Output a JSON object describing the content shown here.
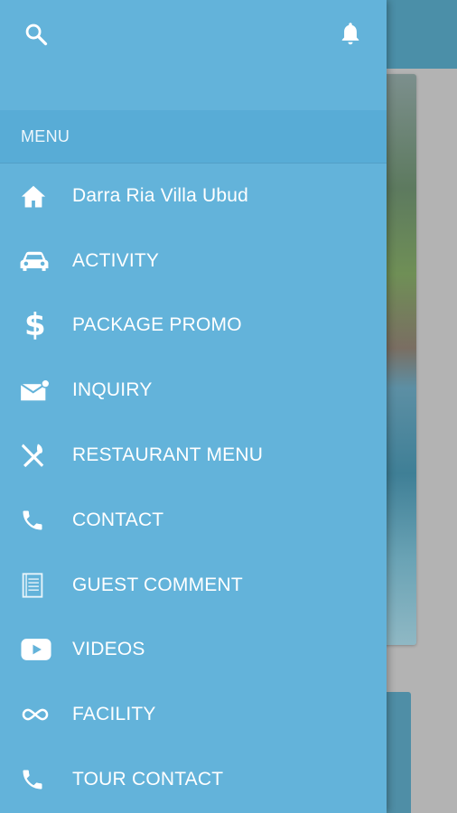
{
  "drawer": {
    "menu_header": "MENU",
    "items": [
      {
        "label": "Darra Ria Villa Ubud",
        "icon": "home-icon"
      },
      {
        "label": "ACTIVITY",
        "icon": "car-icon"
      },
      {
        "label": "PACKAGE PROMO",
        "icon": "dollar-icon"
      },
      {
        "label": "INQUIRY",
        "icon": "mail-notification-icon"
      },
      {
        "label": "RESTAURANT MENU",
        "icon": "cutlery-icon"
      },
      {
        "label": "CONTACT",
        "icon": "phone-icon"
      },
      {
        "label": "GUEST COMMENT",
        "icon": "notepad-icon"
      },
      {
        "label": "VIDEOS",
        "icon": "youtube-icon"
      },
      {
        "label": "FACILITY",
        "icon": "infinity-icon"
      },
      {
        "label": "TOUR CONTACT",
        "icon": "phone-icon"
      }
    ]
  },
  "colors": {
    "drawer_bg": "#63b3da",
    "menu_header_bg": "#58acd6",
    "text": "#ffffff"
  }
}
